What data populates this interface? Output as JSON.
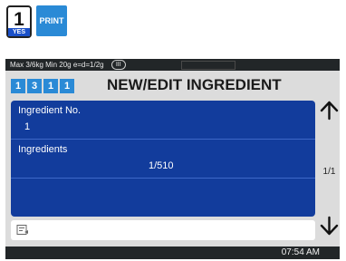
{
  "top_icons": {
    "one_number": "1",
    "one_caption": "YES",
    "print_label": "PRINT"
  },
  "status_bar": {
    "scale_spec": "Max 3/6kg Min 20g e=d=1/2g",
    "class_badge": "III"
  },
  "header": {
    "breadcrumb": [
      "1",
      "3",
      "1",
      "1"
    ],
    "title": "NEW/EDIT INGREDIENT"
  },
  "form": {
    "ingredient_no": {
      "label": "Ingredient No.",
      "value": "1"
    },
    "ingredients": {
      "label": "Ingredients",
      "value": "1/510"
    }
  },
  "pagination": {
    "page": "1/1"
  },
  "footer": {
    "time": "07:54 AM"
  },
  "icons": {
    "up": "arrow-up-icon",
    "down": "arrow-down-icon",
    "memo": "memo-icon"
  },
  "colors": {
    "panel_blue": "#123c9c",
    "accent_blue": "#2a8ad6",
    "window_gray": "#dcdcdc",
    "bar_dark": "#222628"
  }
}
